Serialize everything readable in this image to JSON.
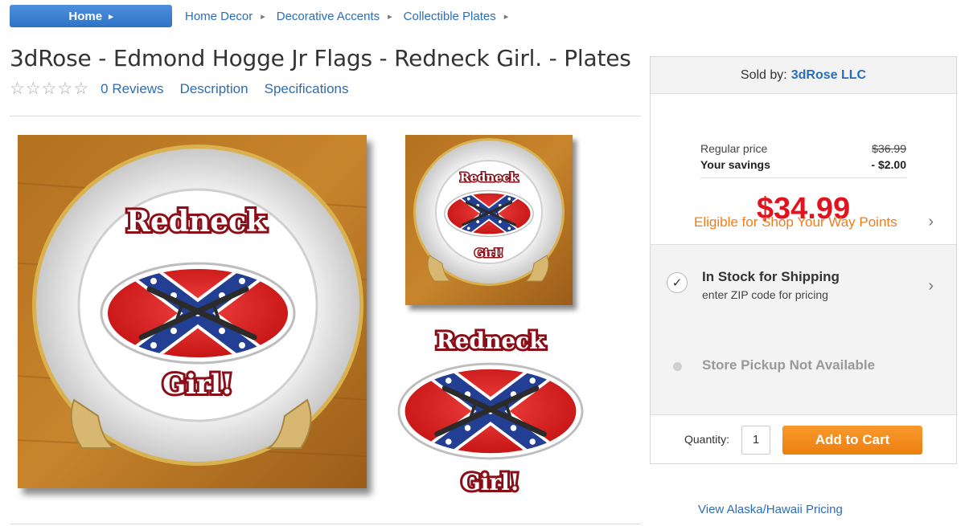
{
  "breadcrumb": {
    "home": "Home",
    "items": [
      "Home Decor",
      "Decorative Accents",
      "Collectible Plates"
    ]
  },
  "product": {
    "title": "3dRose - Edmond Hogge Jr Flags - Redneck Girl. - Plates",
    "rating_stars": 0,
    "reviews_link": "0 Reviews",
    "description_link": "Description",
    "specifications_link": "Specifications"
  },
  "images": {
    "top_text": "Redneck",
    "bottom_text": "Girl!"
  },
  "panel": {
    "sold_by_label": "Sold by:",
    "seller": "3dRose LLC",
    "regular_price_label": "Regular price",
    "regular_price": "$36.99",
    "savings_label": "Your savings",
    "savings": "- $2.00",
    "price": "$34.99",
    "points_link": "Eligible for Shop Your Way Points",
    "stock_title": "In Stock for Shipping",
    "stock_sub": "enter ZIP code for pricing",
    "pickup": "Store Pickup Not Available",
    "quantity_label": "Quantity:",
    "quantity": "1",
    "add_to_cart": "Add to Cart"
  },
  "footer_link": "View Alaska/Hawaii Pricing",
  "colors": {
    "link": "#2a6ebb",
    "price": "#e0141e",
    "cart_button": "#f28b1e",
    "points": "#f07c1c"
  }
}
